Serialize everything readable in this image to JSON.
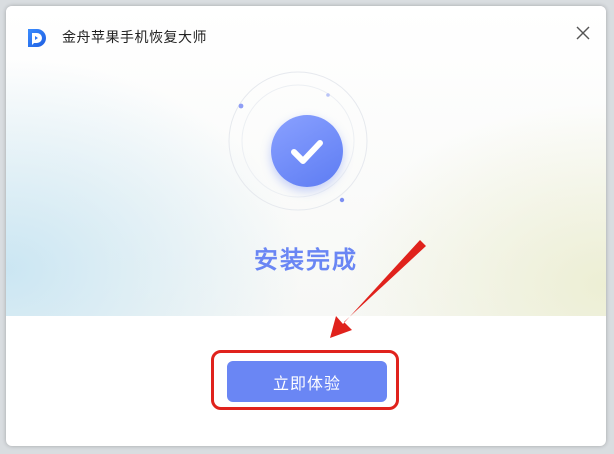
{
  "window": {
    "title": "金舟苹果手机恢复大师",
    "close_icon": "close-icon",
    "logo_icon": "app-logo-icon"
  },
  "main": {
    "status_title": "安装完成",
    "status_icon": "checkmark-icon",
    "primary_button_label": "立即体验"
  },
  "colors": {
    "accent": "#6a86f4",
    "annotation": "#e0221c"
  }
}
